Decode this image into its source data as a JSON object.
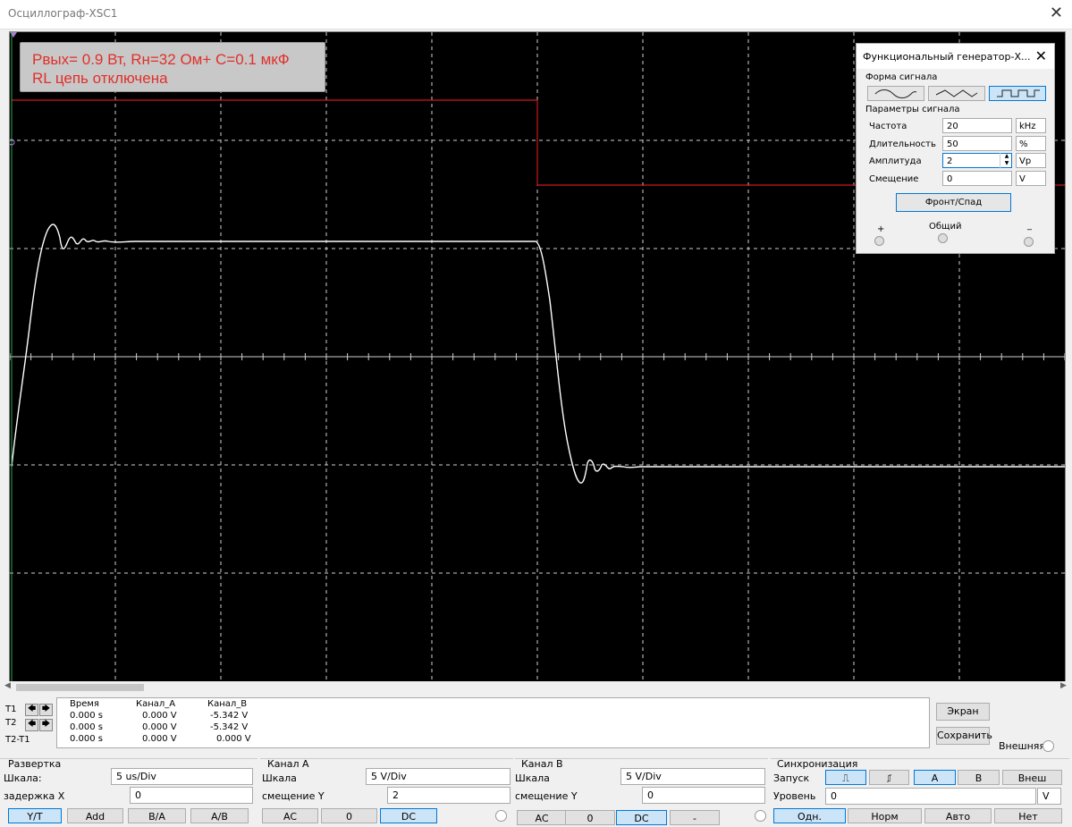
{
  "window": {
    "title": "Осциллограф-XSC1",
    "close": "✕"
  },
  "annotation": {
    "line1": "Pвых= 0.9 Вт, Rн=32 Ом+ С=0.1 мкФ",
    "line2": "RL цепь отключена",
    "color": "#e0302a"
  },
  "colors": {
    "background": "#000000",
    "grid": "#cfcfcf",
    "channel_a": "#ffffff",
    "channel_b": "#d01818"
  },
  "function_generator": {
    "title": "Функциональный генератор-X...",
    "close": "✕",
    "waveform_label": "Форма сигнала",
    "waveforms": [
      "sine",
      "triangle",
      "square"
    ],
    "selected_waveform": "square",
    "params_label": "Параметры сигнала",
    "params": [
      {
        "name": "Частота",
        "value": "20",
        "unit": "kHz"
      },
      {
        "name": "Длительность",
        "value": "50",
        "unit": "%"
      },
      {
        "name": "Амплитуда",
        "value": "2",
        "unit": "Vp"
      },
      {
        "name": "Смещение",
        "value": "0",
        "unit": "V"
      }
    ],
    "edge_button": "Фронт/Спад",
    "terminals": {
      "plus": "+",
      "common": "Общий",
      "minus": "_"
    }
  },
  "measurements": {
    "headers": [
      "Время",
      "Канал_A",
      "Канал_B"
    ],
    "rows": [
      {
        "label": "T1",
        "time": "0.000 s",
        "a": "0.000 V",
        "b": "-5.342 V"
      },
      {
        "label": "T2",
        "time": "0.000 s",
        "a": "0.000 V",
        "b": "-5.342 V"
      },
      {
        "label": "T2-T1",
        "time": "0.000 s",
        "a": "0.000 V",
        "b": "0.000 V"
      }
    ]
  },
  "side_buttons": {
    "screen": "Экран",
    "save": "Сохранить",
    "external": "Внешняя"
  },
  "timebase": {
    "title": "Развертка",
    "scale_label": "Шкала:",
    "scale": "5 us/Div",
    "delay_label": "задержка X",
    "delay": "0",
    "modes": [
      "Y/T",
      "Add",
      "B/A",
      "A/B"
    ],
    "selected_mode": "Y/T"
  },
  "channel_a": {
    "title": "Канал A",
    "scale_label": "Шкала",
    "scale": "5  V/Div",
    "offset_label": "смещение Y",
    "offset": "2",
    "coupling": [
      "AC",
      "0",
      "DC"
    ],
    "selected": "DC"
  },
  "channel_b": {
    "title": "Канал B",
    "scale_label": "Шкала",
    "scale": "5  V/Div",
    "offset_label": "смещение Y",
    "offset": "0",
    "coupling": [
      "AC",
      "0",
      "DC",
      "-"
    ],
    "selected": "DC"
  },
  "trigger": {
    "title": "Синхронизация",
    "edge_label": "Запуск",
    "edges": [
      "rising",
      "falling"
    ],
    "sources": [
      "A",
      "B",
      "Внеш"
    ],
    "selected_source": "A",
    "level_label": "Уровень",
    "level": "0",
    "level_unit": "V",
    "modes": [
      "Одн.",
      "Норм",
      "Авто",
      "Нет"
    ],
    "selected_mode": "Одн."
  }
}
